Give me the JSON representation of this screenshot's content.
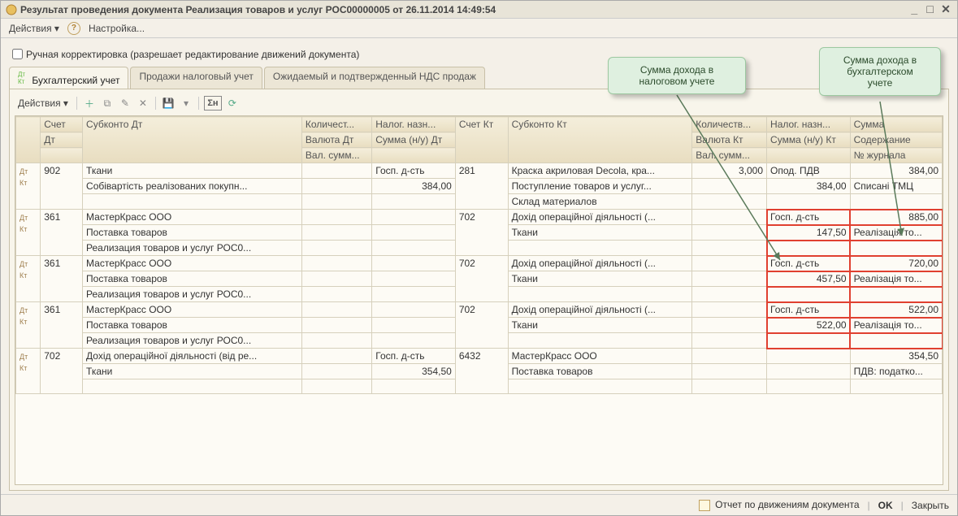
{
  "window": {
    "title": "Результат проведения документа Реализация товаров и услуг РОС00000005 от 26.11.2014 14:49:54"
  },
  "menubar": {
    "actions": "Действия",
    "settings": "Настройка..."
  },
  "manual_checkbox": {
    "label": "Ручная корректировка (разрешает редактирование движений документа)"
  },
  "tabs": [
    {
      "label": "Бухгалтерский учет",
      "active": true
    },
    {
      "label": "Продажи налоговый учет",
      "active": false
    },
    {
      "label": "Ожидаемый и подтвержденный НДС продаж",
      "active": false
    }
  ],
  "toolbar_actions": "Действия",
  "headers": {
    "r1": {
      "acc_dt": "Счет",
      "sub_dt": "Субконто Дт",
      "qty_dt": "Количест...",
      "tax_dt": "Налог. назн...",
      "acc_kt": "Счет Кт",
      "sub_kt": "Субконто Кт",
      "qty_kt": "Количеств...",
      "tax_kt": "Налог. назн...",
      "sum": "Сумма"
    },
    "r2": {
      "acc_dt": "Дт",
      "qty_dt": "Валюта Дт",
      "tax_dt": "Сумма (н/у) Дт",
      "qty_kt": "Валюта Кт",
      "tax_kt": "Сумма (н/у) Кт",
      "sum": "Содержание"
    },
    "r3": {
      "qty_dt": "Вал. сумм...",
      "qty_kt": "Вал. сумм...",
      "sum": "№ журнала"
    }
  },
  "rows": [
    {
      "acc_dt": "902",
      "sub_dt": [
        "Ткани",
        "Собівартість реалізованих покупн..."
      ],
      "qty_dt": [
        "",
        "",
        ""
      ],
      "tax_dt": [
        "Госп. д-сть",
        "384,00",
        ""
      ],
      "acc_kt": "281",
      "sub_kt": [
        "Краска акриловая Decola, кра...",
        "Поступление товаров и услуг...",
        "Склад материалов"
      ],
      "qty_kt": [
        "3,000",
        "",
        ""
      ],
      "tax_kt": [
        "Опод. ПДВ",
        "384,00",
        ""
      ],
      "sum": [
        "384,00",
        "Списані ТМЦ",
        ""
      ]
    },
    {
      "acc_dt": "361",
      "sub_dt": [
        " МастерКрасс ООО",
        "Поставка товаров",
        "Реализация товаров и услуг РОС0..."
      ],
      "qty_dt": [
        "",
        "",
        ""
      ],
      "tax_dt": [
        "",
        "",
        ""
      ],
      "acc_kt": "702",
      "sub_kt": [
        "Дохід операційної діяльності (...",
        "Ткани",
        ""
      ],
      "qty_kt": [
        "",
        "",
        ""
      ],
      "tax_kt": [
        "Госп. д-сть",
        "147,50",
        ""
      ],
      "sum": [
        "885,00",
        "Реалізація то...",
        ""
      ]
    },
    {
      "acc_dt": "361",
      "sub_dt": [
        " МастерКрасс ООО",
        "Поставка товаров",
        "Реализация товаров и услуг РОС0..."
      ],
      "qty_dt": [
        "",
        "",
        ""
      ],
      "tax_dt": [
        "",
        "",
        ""
      ],
      "acc_kt": "702",
      "sub_kt": [
        "Дохід операційної діяльності (...",
        "Ткани",
        ""
      ],
      "qty_kt": [
        "",
        "",
        ""
      ],
      "tax_kt": [
        "Госп. д-сть",
        "457,50",
        ""
      ],
      "sum": [
        "720,00",
        "Реалізація то...",
        ""
      ]
    },
    {
      "acc_dt": "361",
      "sub_dt": [
        " МастерКрасс ООО",
        "Поставка товаров",
        "Реализация товаров и услуг РОС0..."
      ],
      "qty_dt": [
        "",
        "",
        ""
      ],
      "tax_dt": [
        "",
        "",
        ""
      ],
      "acc_kt": "702",
      "sub_kt": [
        "Дохід операційної діяльності (...",
        "Ткани",
        ""
      ],
      "qty_kt": [
        "",
        "",
        ""
      ],
      "tax_kt": [
        "Госп. д-сть",
        "522,00",
        ""
      ],
      "sum": [
        "522,00",
        "Реалізація то...",
        ""
      ]
    },
    {
      "acc_dt": "702",
      "sub_dt": [
        "Дохід операційної діяльності (від ре...",
        "Ткани",
        ""
      ],
      "qty_dt": [
        "",
        "",
        ""
      ],
      "tax_dt": [
        "Госп. д-сть",
        "354,50",
        ""
      ],
      "acc_kt": "6432",
      "sub_kt": [
        " МастерКрасс ООО",
        "Поставка товаров",
        ""
      ],
      "qty_kt": [
        "",
        "",
        ""
      ],
      "tax_kt": [
        "",
        "",
        ""
      ],
      "sum": [
        "354,50",
        "ПДВ: податко...",
        ""
      ]
    }
  ],
  "callouts": {
    "tax": "Сумма дохода в\nналоговом учете",
    "acct": "Сумма дохода в\nбухгалтерском\nучете"
  },
  "footer": {
    "report": "Отчет по движениям документа",
    "ok": "OK",
    "close": "Закрыть"
  }
}
